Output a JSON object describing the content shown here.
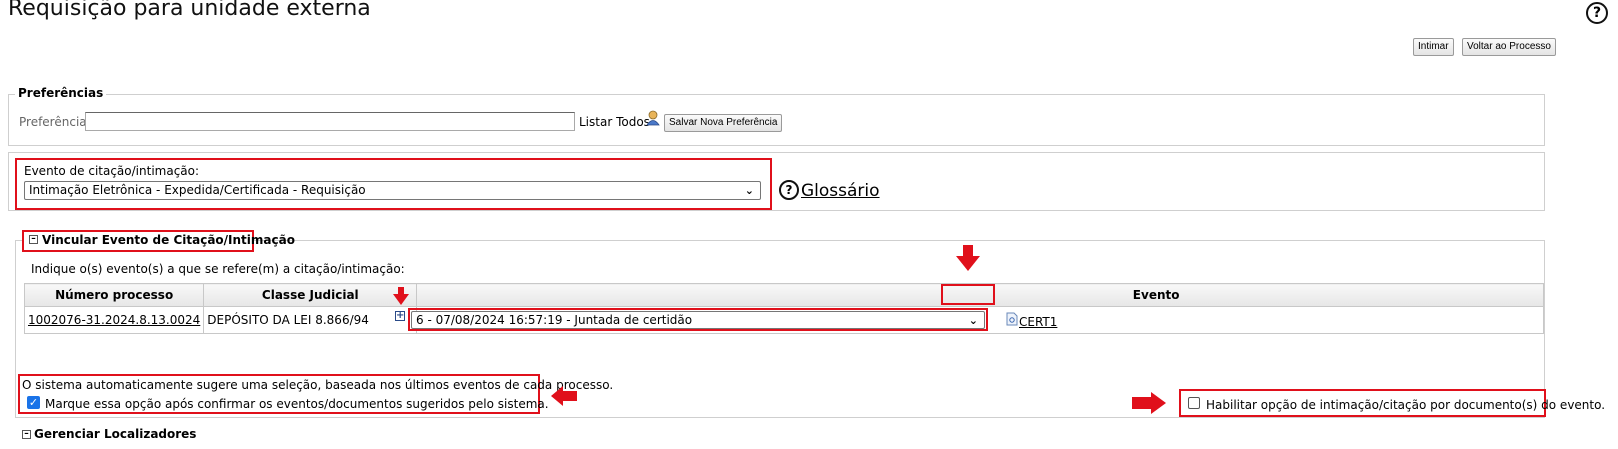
{
  "page": {
    "title": "Requisição para unidade externa",
    "help_icon": "question-circle-icon"
  },
  "toolbar": {
    "intimar_label": "Intimar",
    "voltar_label": "Voltar ao Processo"
  },
  "preferencias": {
    "legend": "Preferências",
    "field_label": "Preferência:",
    "field_value": "",
    "listar_todos": "Listar Todos",
    "user_icon": "user-icon",
    "salvar_label": "Salvar Nova Preferência"
  },
  "evento": {
    "label": "Evento de citação/intimação:",
    "selected": "Intimação Eletrônica - Expedida/Certificada - Requisição",
    "glossario": "Glossário"
  },
  "vincular": {
    "toggle_icon": "minus-box-icon",
    "legend": "Vincular Evento de Citação/Intimação",
    "instruction": "Indique o(s) evento(s) a que se refere(m) a citação/intimação:",
    "columns": [
      "Número processo",
      "Classe Judicial",
      "Evento"
    ],
    "rows": [
      {
        "numero": "1002076-31.2024.8.13.0024",
        "classe": "DEPÓSITO DA LEI 8.866/94",
        "expand_icon": "plus-box-icon",
        "evento_selected": "6 - 07/08/2024 16:57:19 - Juntada de certidão",
        "doc_icon": "document-icon",
        "doc_label": "CERT1"
      }
    ],
    "auto_text": "O sistema automaticamente sugere uma seleção, baseada nos últimos eventos de cada processo.",
    "confirm_checkbox_label": "Marque essa opção após confirmar os eventos/documentos sugeridos pelo sistema.",
    "confirm_checked": true,
    "habilitar_label": "Habilitar opção de intimação/citação por documento(s) do evento.",
    "habilitar_checked": false
  },
  "gerenciar": {
    "toggle_icon": "minus-box-icon",
    "legend": "Gerenciar Localizadores"
  },
  "annotation_color": "#e0101b"
}
